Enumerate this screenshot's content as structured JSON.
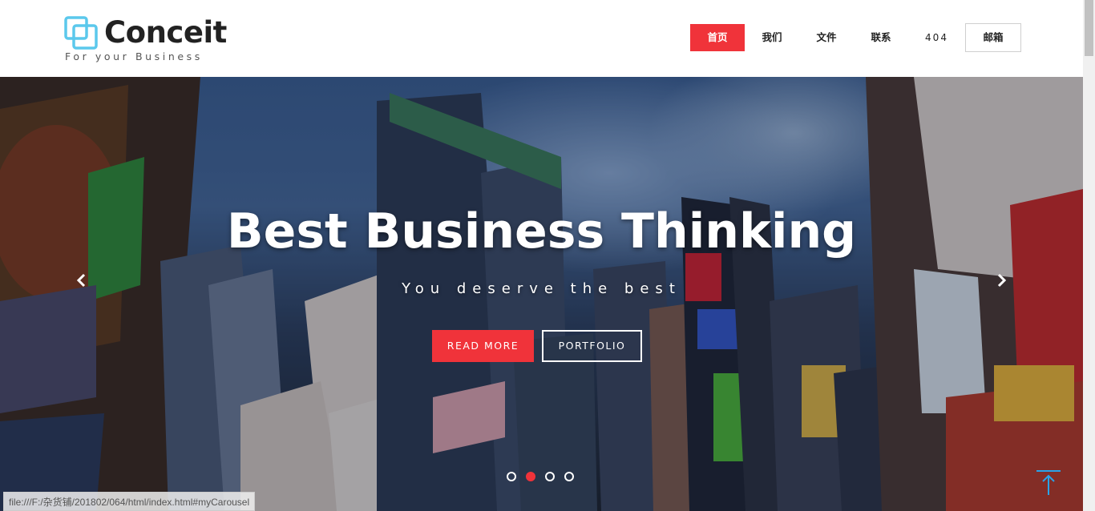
{
  "brand": {
    "name": "Conceit",
    "tagline": "For your Business",
    "color": "#5bc8ec"
  },
  "nav": {
    "items": [
      {
        "label": "首页",
        "active": true
      },
      {
        "label": "我们"
      },
      {
        "label": "文件"
      },
      {
        "label": "联系"
      },
      {
        "label": "404"
      },
      {
        "label": "邮箱"
      }
    ]
  },
  "hero": {
    "title": "Best Business Thinking",
    "subtitle": "You deserve the best",
    "read_more_label": "READ MORE",
    "portfolio_label": "PORTFOLIO",
    "prev_icon": "chevron-left-icon",
    "next_icon": "chevron-right-icon",
    "slides_total": 4,
    "active_slide": 2
  },
  "status_bar": {
    "url": "file:///F:/杂货铺/201802/064/html/index.html#myCarousel"
  },
  "colors": {
    "accent": "#f0333a",
    "text": "#222222"
  }
}
